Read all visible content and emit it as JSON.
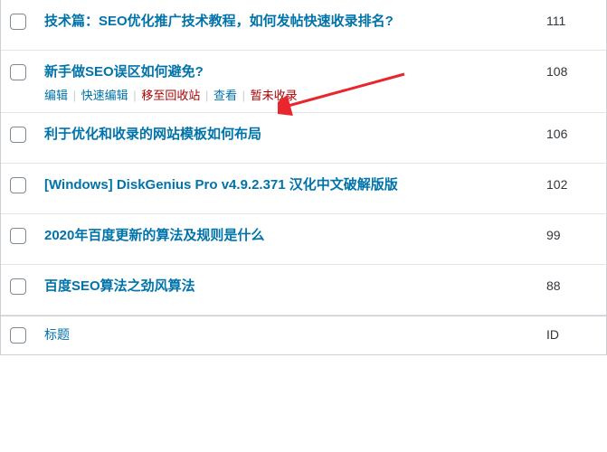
{
  "rows": [
    {
      "title": "技术篇：SEO优化推广技术教程，如何发帖快速收录排名?",
      "id": "111",
      "show_actions": false
    },
    {
      "title": "新手做SEO误区如何避免?",
      "id": "108",
      "show_actions": true
    },
    {
      "title": "利于优化和收录的网站模板如何布局",
      "id": "106",
      "show_actions": false
    },
    {
      "title": "[Windows] DiskGenius Pro v4.9.2.371 汉化中文破解版版",
      "id": "102",
      "show_actions": false
    },
    {
      "title": "2020年百度更新的算法及规则是什么",
      "id": "99",
      "show_actions": false
    },
    {
      "title": "百度SEO算法之劲风算法",
      "id": "88",
      "show_actions": false
    }
  ],
  "actions": {
    "edit": "编辑",
    "quick_edit": "快速编辑",
    "trash": "移至回收站",
    "view": "查看",
    "unindexed": "暂未收录"
  },
  "footer": {
    "title": "标题",
    "id": "ID"
  }
}
